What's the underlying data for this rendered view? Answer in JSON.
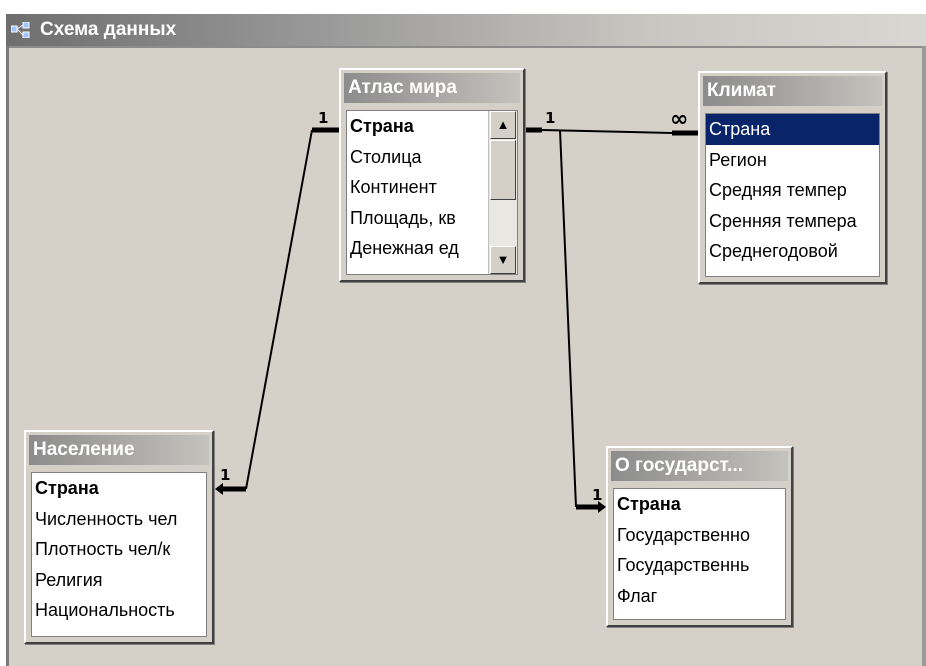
{
  "window": {
    "title": "Схема данных"
  },
  "tables": {
    "atlas": {
      "title": "Атлас мира",
      "fields": [
        "Страна",
        "Столица",
        "Континент",
        "Площадь, кв",
        "Денежная ед"
      ],
      "scroll_up": "▲",
      "scroll_down": "▼"
    },
    "climate": {
      "title": "Климат",
      "fields": [
        "Страна",
        "Регион",
        "Средняя темпер",
        "Сренняя темпера",
        "Среднегодовой"
      ]
    },
    "population": {
      "title": "Население",
      "fields": [
        "Страна",
        "Численность чел",
        "Плотность чел/к",
        "Религия",
        "Национальность"
      ]
    },
    "state": {
      "title": "О государст...",
      "fields": [
        "Страна",
        "Государственно",
        "Государственнь",
        "Флаг"
      ]
    }
  },
  "relations": {
    "atlas_climate": {
      "one": "1",
      "many": "∞"
    },
    "atlas_population": {
      "one": "1",
      "other": "1"
    },
    "atlas_state": {
      "one": "1",
      "other": "1"
    }
  },
  "colors": {
    "selection": "#0a246a",
    "window_bg": "#d5d1c8"
  }
}
